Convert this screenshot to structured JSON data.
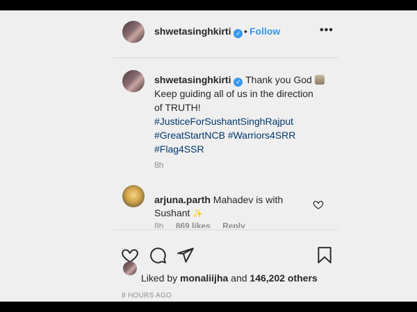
{
  "header": {
    "username": "shwetasinghkirti",
    "separator": "•",
    "follow_label": "Follow",
    "more_icon": "more-options-icon"
  },
  "caption": {
    "username": "shwetasinghkirti",
    "line1": "Thank you God",
    "line2": "Keep guiding all of us in the direction",
    "line3": "of TRUTH!",
    "hashtags": [
      "#JusticeForSushantSinghRajput",
      "#GreatStartNCB",
      "#Warriors4SRR",
      "#Flag4SSR"
    ],
    "time": "8h"
  },
  "comment": {
    "username": "arjuna.parth",
    "text_part1": "Mahadev is with",
    "text_part2": "Sushant",
    "time": "8h",
    "likes": "869 likes",
    "reply_label": "Reply"
  },
  "actions": {
    "like_icon": "heart-icon",
    "comment_icon": "comment-icon",
    "share_icon": "share-icon",
    "save_icon": "bookmark-icon"
  },
  "liked_by": {
    "prefix": "Liked by",
    "user": "monaliijha",
    "joiner": "and",
    "count": "146,202 others"
  },
  "posted": "8 HOURS AGO",
  "colors": {
    "background": "#efefef",
    "link": "#3897f0",
    "hashtag": "#00376b",
    "muted": "#8e8e8e",
    "text": "#262626"
  }
}
